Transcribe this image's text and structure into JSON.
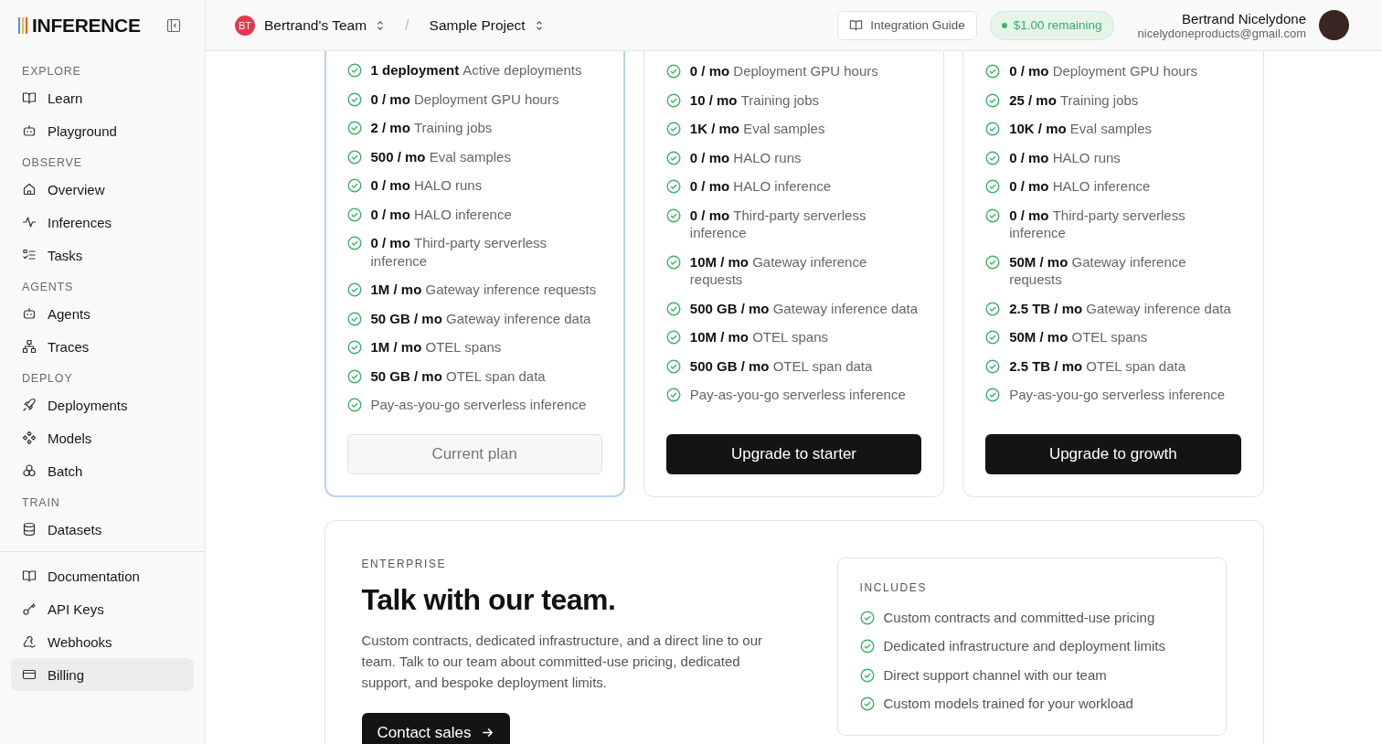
{
  "sidebar": {
    "logo": "INFERENCE",
    "sections": [
      {
        "heading": "EXPLORE",
        "items": [
          {
            "label": "Learn",
            "selected": false
          },
          {
            "label": "Playground",
            "selected": false
          }
        ]
      },
      {
        "heading": "OBSERVE",
        "items": [
          {
            "label": "Overview",
            "selected": false
          },
          {
            "label": "Inferences",
            "selected": false
          },
          {
            "label": "Tasks",
            "selected": false
          }
        ]
      },
      {
        "heading": "AGENTS",
        "items": [
          {
            "label": "Agents",
            "selected": false
          },
          {
            "label": "Traces",
            "selected": false
          }
        ]
      },
      {
        "heading": "DEPLOY",
        "items": [
          {
            "label": "Deployments",
            "selected": false
          },
          {
            "label": "Models",
            "selected": false
          },
          {
            "label": "Batch",
            "selected": false
          }
        ]
      },
      {
        "heading": "TRAIN",
        "items": [
          {
            "label": "Datasets",
            "selected": false
          }
        ]
      },
      {
        "items": [
          {
            "label": "Documentation",
            "selected": false
          },
          {
            "label": "API Keys",
            "selected": false
          },
          {
            "label": "Webhooks",
            "selected": false
          },
          {
            "label": "Billing",
            "selected": true
          }
        ]
      }
    ]
  },
  "header": {
    "team": {
      "initials": "BT",
      "name": "Bertrand's Team"
    },
    "separator": "/",
    "project": "Sample Project",
    "guide": "Integration Guide",
    "credit": "$1.00 remaining",
    "user": {
      "name": "Bertrand Nicelydone",
      "email": "nicelydoneproducts@gmail.com"
    }
  },
  "plans": [
    {
      "selected": true,
      "button": "Current plan",
      "features": [
        {
          "amount": "1 deployment",
          "label": "Active deployments"
        },
        {
          "amount": "0 / mo",
          "label": "Deployment GPU hours"
        },
        {
          "amount": "2 / mo",
          "label": "Training jobs"
        },
        {
          "amount": "500 / mo",
          "label": "Eval samples"
        },
        {
          "amount": "0 / mo",
          "label": "HALO runs"
        },
        {
          "amount": "0 / mo",
          "label": "HALO inference"
        },
        {
          "amount": "0 / mo",
          "label": "Third-party serverless inference"
        },
        {
          "amount": "1M / mo",
          "label": "Gateway inference requests"
        },
        {
          "amount": "50 GB / mo",
          "label": "Gateway inference data"
        },
        {
          "amount": "1M / mo",
          "label": "OTEL spans"
        },
        {
          "amount": "50 GB / mo",
          "label": "OTEL span data"
        },
        {
          "label": "Pay-as-you-go serverless inference"
        }
      ]
    },
    {
      "selected": false,
      "button": "Upgrade to starter",
      "features": [
        {
          "amount": "0 / mo",
          "label": "Deployment GPU hours"
        },
        {
          "amount": "10 / mo",
          "label": "Training jobs"
        },
        {
          "amount": "1K / mo",
          "label": "Eval samples"
        },
        {
          "amount": "0 / mo",
          "label": "HALO runs"
        },
        {
          "amount": "0 / mo",
          "label": "HALO inference"
        },
        {
          "amount": "0 / mo",
          "label": "Third-party serverless inference"
        },
        {
          "amount": "10M / mo",
          "label": "Gateway inference requests"
        },
        {
          "amount": "500 GB / mo",
          "label": "Gateway inference data"
        },
        {
          "amount": "10M / mo",
          "label": "OTEL spans"
        },
        {
          "amount": "500 GB / mo",
          "label": "OTEL span data"
        },
        {
          "label": "Pay-as-you-go serverless inference"
        }
      ]
    },
    {
      "selected": false,
      "button": "Upgrade to growth",
      "features": [
        {
          "amount": "0 / mo",
          "label": "Deployment GPU hours"
        },
        {
          "amount": "25 / mo",
          "label": "Training jobs"
        },
        {
          "amount": "10K / mo",
          "label": "Eval samples"
        },
        {
          "amount": "0 / mo",
          "label": "HALO runs"
        },
        {
          "amount": "0 / mo",
          "label": "HALO inference"
        },
        {
          "amount": "0 / mo",
          "label": "Third-party serverless inference"
        },
        {
          "amount": "50M / mo",
          "label": "Gateway inference requests"
        },
        {
          "amount": "2.5 TB / mo",
          "label": "Gateway inference data"
        },
        {
          "amount": "50M / mo",
          "label": "OTEL spans"
        },
        {
          "amount": "2.5 TB / mo",
          "label": "OTEL span data"
        },
        {
          "label": "Pay-as-you-go serverless inference"
        }
      ]
    }
  ],
  "enterprise": {
    "eyebrow": "ENTERPRISE",
    "title": "Talk with our team.",
    "body": "Custom contracts, dedicated infrastructure, and a direct line to our team. Talk to our team about committed-use pricing, dedicated support, and bespoke deployment limits.",
    "button": "Contact sales",
    "includes": {
      "heading": "INCLUDES",
      "items": [
        "Custom contracts and committed-use pricing",
        "Dedicated infrastructure and deployment limits",
        "Direct support channel with our team",
        "Custom models trained for your workload"
      ]
    }
  }
}
